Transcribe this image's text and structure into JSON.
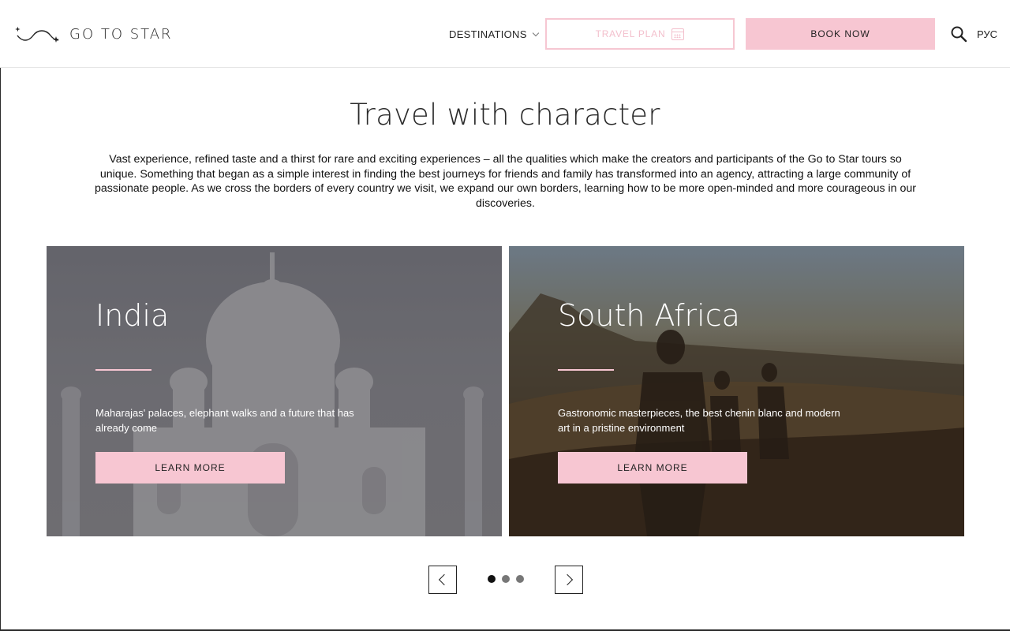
{
  "header": {
    "logo_text": "GO TO STAR",
    "nav_destinations": "DESTINATIONS",
    "travel_plan_label": "TRAVEL PLAN",
    "book_now_label": "BOOK NOW",
    "language_label": "РУС",
    "icons": [
      "logo-mark",
      "chevron-down-icon",
      "calendar-icon",
      "search-icon"
    ]
  },
  "hero": {
    "title": "Travel with character",
    "intro": "Vast experience, refined taste and a thirst for rare and exciting experiences – all the qualities which make the creators and participants of the Go to Star tours so unique. Something that began as a simple interest in finding the best journeys for friends and family has transformed into an agency, attracting a large community of passionate people. As we cross the borders of every country we visit, we expand our own borders, learning how to be more open-minded and more courageous in our discoveries."
  },
  "destinations": [
    {
      "name": "India",
      "description": "Maharajas' palaces, elephant walks and a future that has already come",
      "button_label": "LEARN MORE"
    },
    {
      "name": "South Africa",
      "description": "Gastronomic masterpieces, the best chenin blanc and modern art in a pristine environment",
      "button_label": "LEARN MORE"
    }
  ],
  "carousel": {
    "page_count": 3,
    "active_page": 1
  },
  "colors": {
    "accent_pink": "#f7c6d2",
    "text_dark": "#1a1a1a"
  }
}
